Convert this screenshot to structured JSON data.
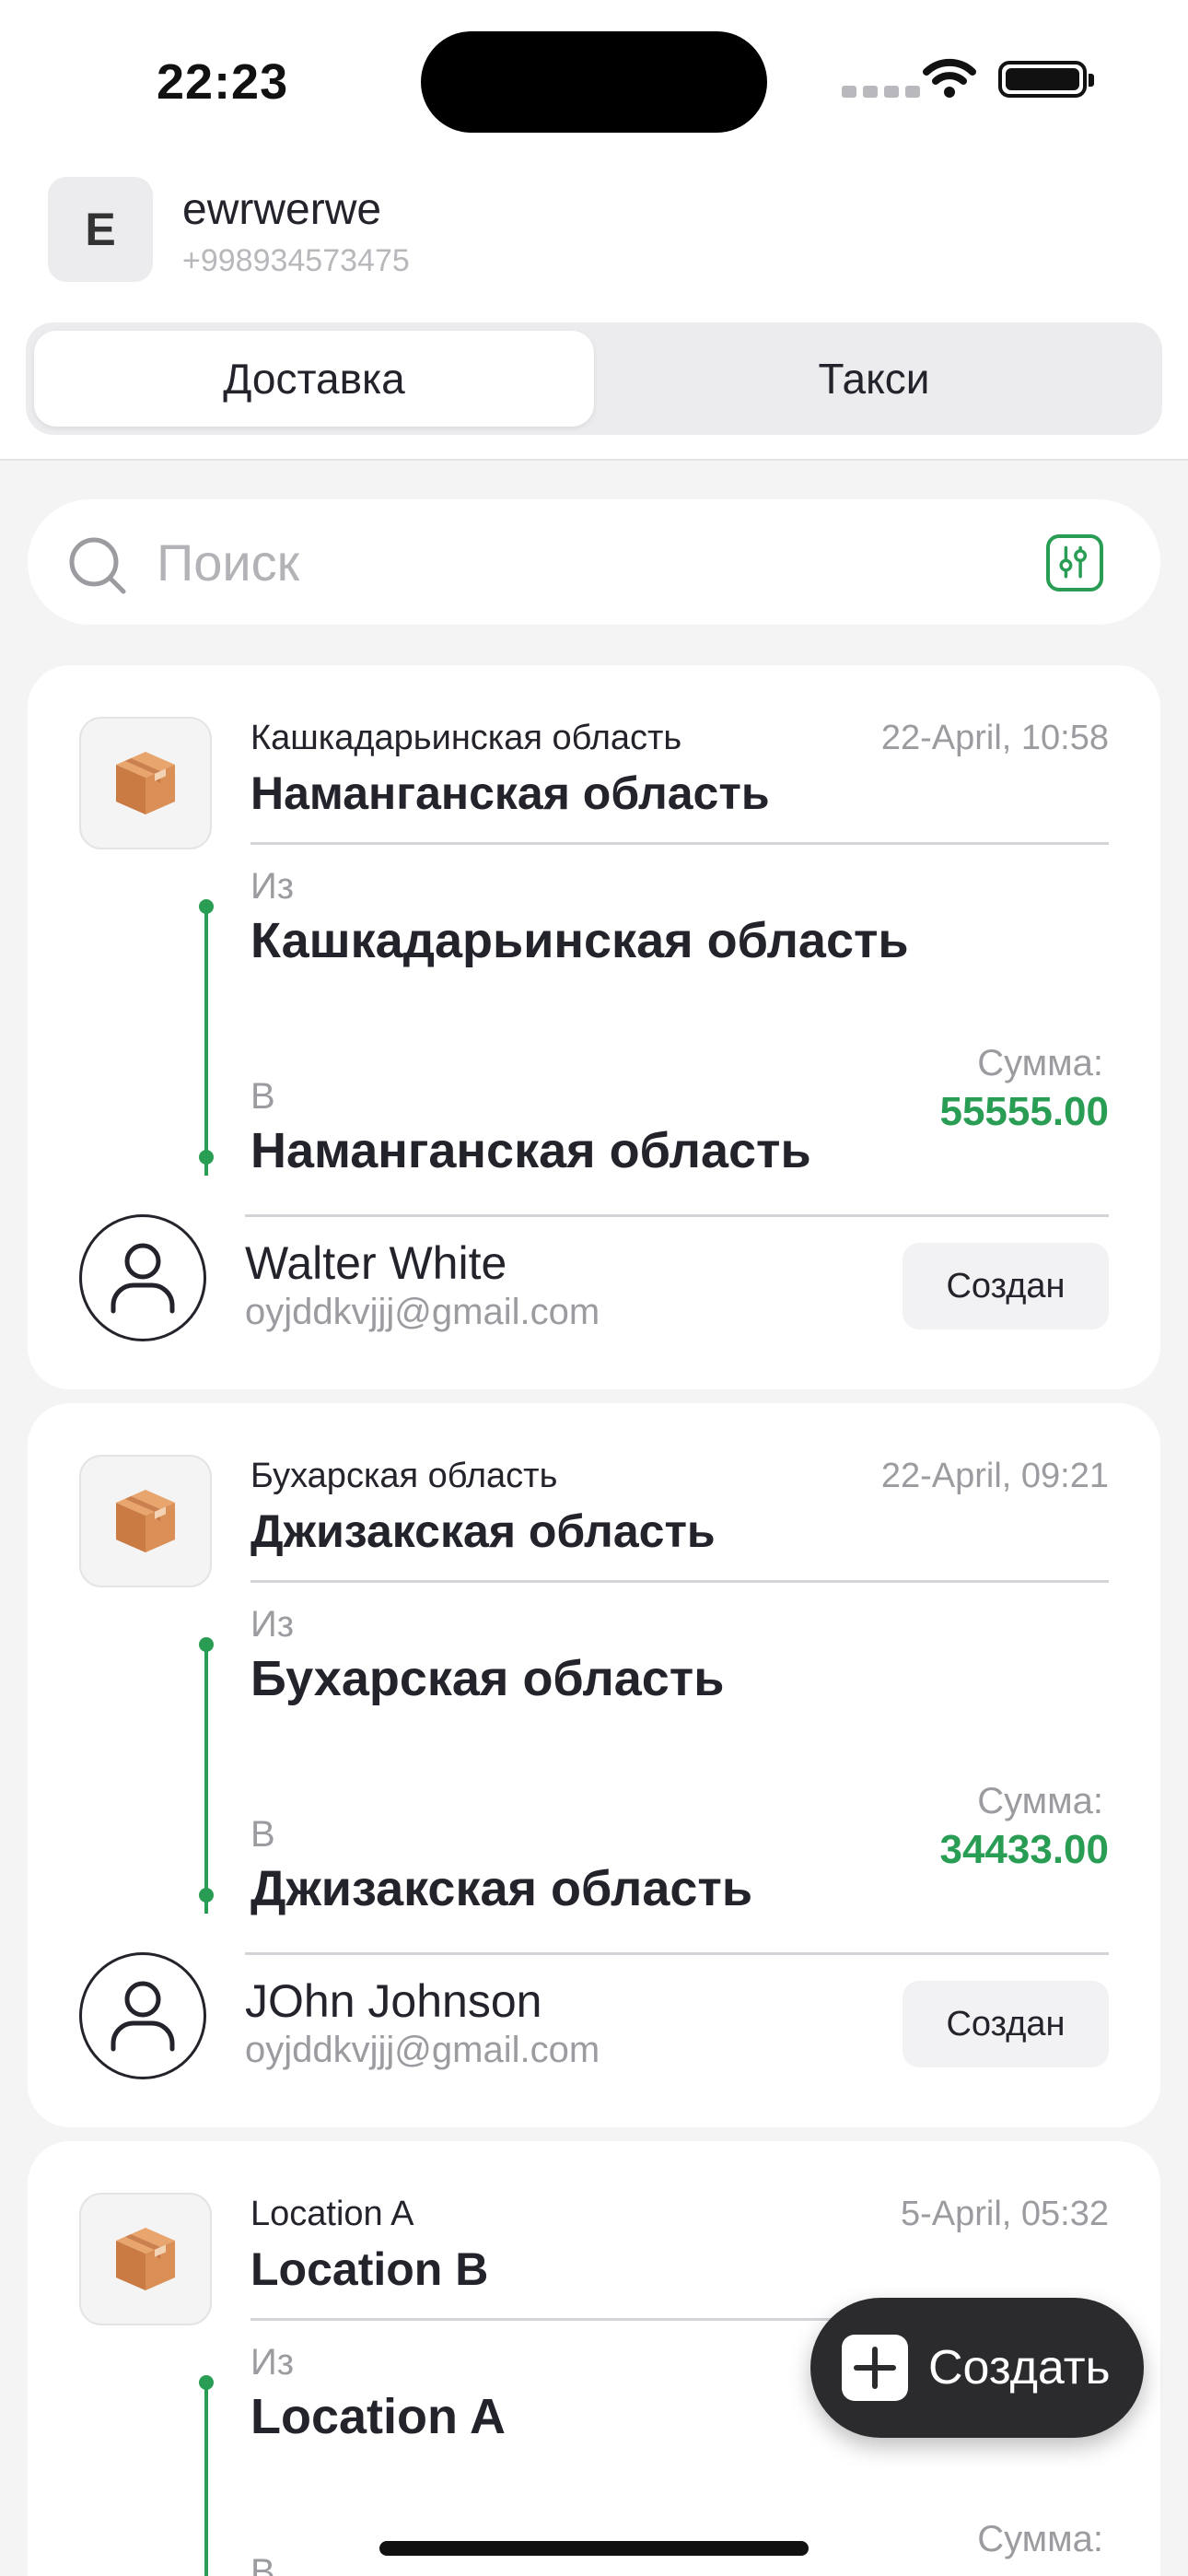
{
  "status_bar": {
    "time": "22:23"
  },
  "header": {
    "avatar_letter": "E",
    "user_name": "ewrwerwe",
    "phone": "+998934573475"
  },
  "tabs": [
    {
      "label": "Доставка",
      "active": true
    },
    {
      "label": "Такси",
      "active": false
    }
  ],
  "search": {
    "placeholder": "Поиск"
  },
  "orders": [
    {
      "from_small": "Кашкадарьинская область",
      "to_big": "Наманганская область",
      "datetime": "22-April, 10:58",
      "from_label": "Из",
      "from": "Кашкадарьинская область",
      "to_label": "В",
      "to": "Наманганская область",
      "sum_label": "Сумма:",
      "sum": "55555.00",
      "customer_name": "Walter White",
      "customer_email": "oyjddkvjjj@gmail.com",
      "status": "Создан"
    },
    {
      "from_small": "Бухарская область",
      "to_big": "Джизакская область",
      "datetime": "22-April, 09:21",
      "from_label": "Из",
      "from": "Бухарская область",
      "to_label": "В",
      "to": "Джизакская область",
      "sum_label": "Сумма:",
      "sum": "34433.00",
      "customer_name": "JOhn Johnson",
      "customer_email": "oyjddkvjjj@gmail.com",
      "status": "Создан"
    },
    {
      "from_small": "Location A",
      "to_big": "Location B",
      "datetime": "5-April, 05:32",
      "from_label": "Из",
      "from": "Location A",
      "to_label": "В",
      "to": "",
      "sum_label": "Сумма:",
      "sum": "",
      "customer_name": "",
      "customer_email": "",
      "status": ""
    }
  ],
  "fab": {
    "label": "Создать"
  },
  "colors": {
    "accent_green": "#2a9d55",
    "fab_bg": "#2b2b2e",
    "page_bg": "#f4f4f5"
  }
}
